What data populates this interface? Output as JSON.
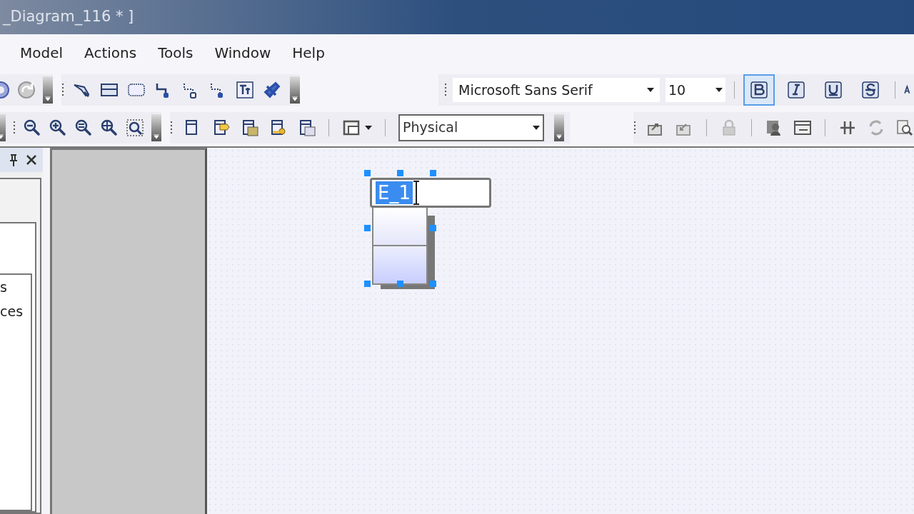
{
  "window": {
    "title": "_Diagram_116 * ]"
  },
  "menu": [
    {
      "label": "Model"
    },
    {
      "label": "Actions"
    },
    {
      "label": "Tools"
    },
    {
      "label": "Window"
    },
    {
      "label": "Help"
    }
  ],
  "font_toolbar": {
    "font_family": "Microsoft Sans Serif",
    "font_size": "10",
    "styles": [
      {
        "kind": "bold",
        "selected": true
      },
      {
        "kind": "italic",
        "selected": false
      },
      {
        "kind": "underline",
        "selected": false
      },
      {
        "kind": "strike",
        "selected": false
      }
    ]
  },
  "view_toolbar": {
    "view_mode": "Physical"
  },
  "side_panel": {
    "items": [
      {
        "label": "s"
      },
      {
        "label": "ces"
      }
    ]
  },
  "diagram": {
    "entity": {
      "name": "E_1",
      "name_selected": true,
      "selected": true
    }
  }
}
